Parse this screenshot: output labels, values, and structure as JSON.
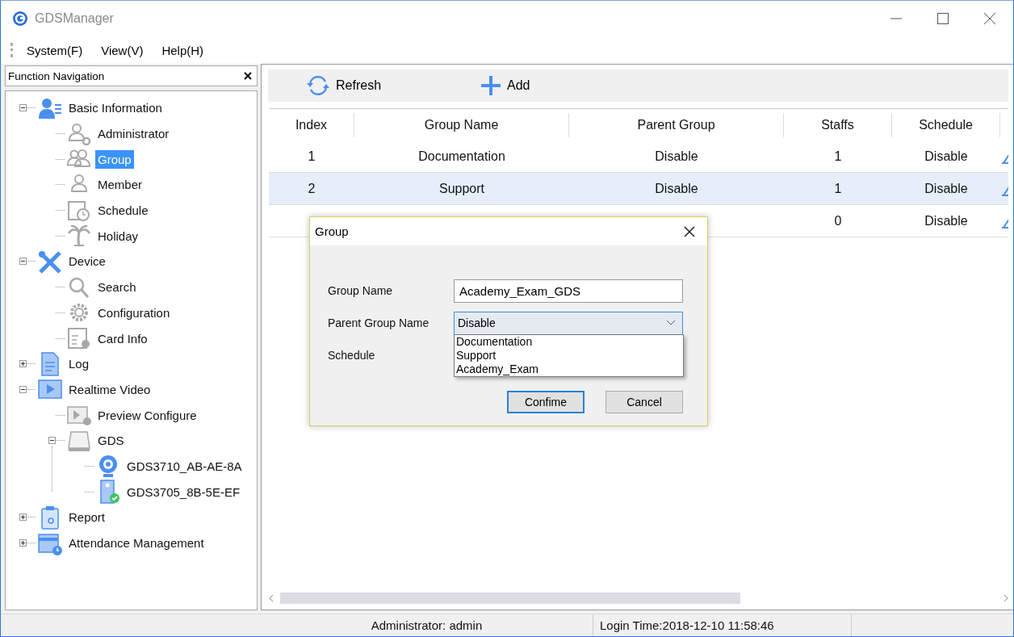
{
  "window": {
    "title": "GDSManager"
  },
  "menu": [
    "System(F)",
    "View(V)",
    "Help(H)"
  ],
  "navigation": {
    "title": "Function Navigation",
    "tree": [
      {
        "label": "Basic Information",
        "selected": false,
        "expanded": true,
        "children": [
          {
            "label": "Administrator",
            "selected": false
          },
          {
            "label": "Group",
            "selected": true
          },
          {
            "label": "Member",
            "selected": false
          },
          {
            "label": "Schedule",
            "selected": false
          },
          {
            "label": "Holiday",
            "selected": false
          }
        ]
      },
      {
        "label": "Device",
        "selected": false,
        "expanded": true,
        "children": [
          {
            "label": "Search",
            "selected": false
          },
          {
            "label": "Configuration",
            "selected": false
          },
          {
            "label": "Card Info",
            "selected": false
          }
        ]
      },
      {
        "label": "Log",
        "selected": false,
        "expanded": false
      },
      {
        "label": "Realtime Video",
        "selected": false,
        "expanded": true,
        "children": [
          {
            "label": "Preview Configure",
            "selected": false
          },
          {
            "label": "GDS",
            "selected": false,
            "expanded": true,
            "children": [
              {
                "label": "GDS3710_AB-AE-8A",
                "selected": false
              },
              {
                "label": "GDS3705_8B-5E-EF",
                "selected": false
              }
            ]
          }
        ]
      },
      {
        "label": "Report",
        "selected": false,
        "expanded": false
      },
      {
        "label": "Attendance Management",
        "selected": false,
        "expanded": false
      }
    ]
  },
  "toolbar": {
    "buttons": [
      "Refresh",
      "Add"
    ]
  },
  "table": {
    "columns": [
      "Index",
      "Group Name",
      "Parent Group",
      "Staffs",
      "Schedule"
    ],
    "rows": [
      {
        "index": "1",
        "group_name": "Documentation",
        "parent_group": "Disable",
        "staffs": "1",
        "schedule": "Disable",
        "selected": false
      },
      {
        "index": "2",
        "group_name": "Support",
        "parent_group": "Disable",
        "staffs": "1",
        "schedule": "Disable",
        "selected": true
      },
      {
        "staffs": "0",
        "schedule": "Disable",
        "selected": false
      }
    ]
  },
  "dialog": {
    "title": "Group",
    "fields": [
      {
        "label": "Group Name",
        "kind": "text",
        "value": "Academy_Exam_GDS"
      },
      {
        "label": "Parent Group Name",
        "kind": "select",
        "value": "Disable",
        "expanded": true,
        "options": [
          {
            "label": "Documentation",
            "selected": false
          },
          {
            "label": "Support",
            "selected": false
          },
          {
            "label": "Academy_Exam",
            "selected": false
          }
        ]
      },
      {
        "label": "Schedule",
        "kind": "label"
      }
    ],
    "buttons": [
      {
        "label": "Confime",
        "focused": true
      },
      {
        "label": "Cancel",
        "focused": false
      }
    ]
  },
  "status_bar": [
    "Administrator: admin",
    "Login Time:2018-12-10 11:58:46"
  ]
}
